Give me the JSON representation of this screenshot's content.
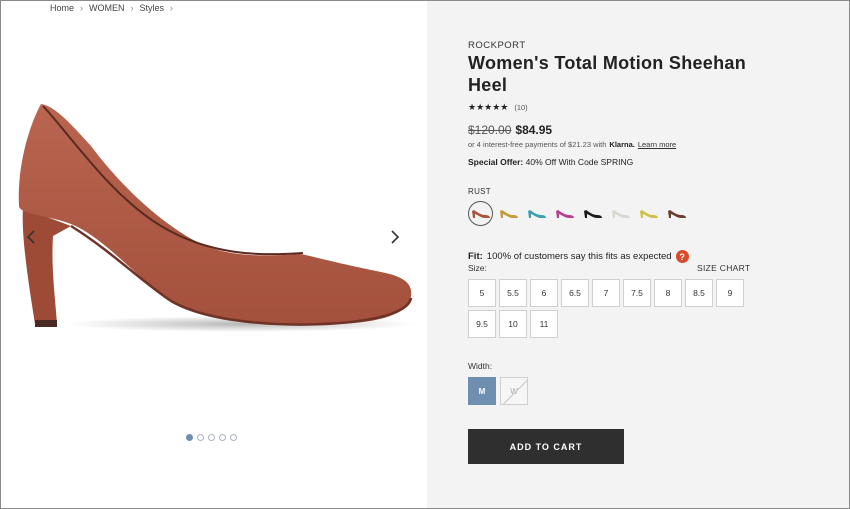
{
  "breadcrumb": [
    "Home",
    "WOMEN",
    "Styles"
  ],
  "product": {
    "brand": "ROCKPORT",
    "title": "Women's Total Motion Sheehan Heel",
    "stars": "★★★★★",
    "review_count": "(10)",
    "old_price": "$120.00",
    "new_price": "$84.95",
    "installments_text": "or 4 interest-free payments of $21.23 with",
    "klarna": "Klarna.",
    "learn_more": "Learn more",
    "offer_label": "Special Offer:",
    "offer_text": "40% Off With Code SPRING",
    "color_name": "RUST",
    "swatches": [
      {
        "name": "rust",
        "color": "#a8553f"
      },
      {
        "name": "mustard",
        "color": "#c49a3a"
      },
      {
        "name": "teal",
        "color": "#3d9fb0"
      },
      {
        "name": "magenta",
        "color": "#b83e8e"
      },
      {
        "name": "black",
        "color": "#1c1c1c"
      },
      {
        "name": "silver",
        "color": "#d8d8d0"
      },
      {
        "name": "yellow",
        "color": "#cfc24a"
      },
      {
        "name": "brown",
        "color": "#6b3d2e"
      }
    ],
    "fit_label": "Fit:",
    "fit_text": "100% of customers say this fits as expected",
    "fit_help": "?",
    "size_label": "Size:",
    "size_chart": "SIZE CHART",
    "sizes": [
      "5",
      "5.5",
      "6",
      "6.5",
      "7",
      "7.5",
      "8",
      "8.5",
      "9",
      "9.5",
      "10",
      "11"
    ],
    "width_label": "Width:",
    "widths": [
      "M",
      "W"
    ],
    "add_to_cart": "ADD TO CART"
  },
  "gallery": {
    "dot_count": 5,
    "active_dot": 0
  },
  "colors": {
    "accent": "#6f8fb0",
    "cart_button": "#2f2f2f",
    "help_icon": "#d84a2b",
    "panel_bg": "#f3f3f3"
  }
}
